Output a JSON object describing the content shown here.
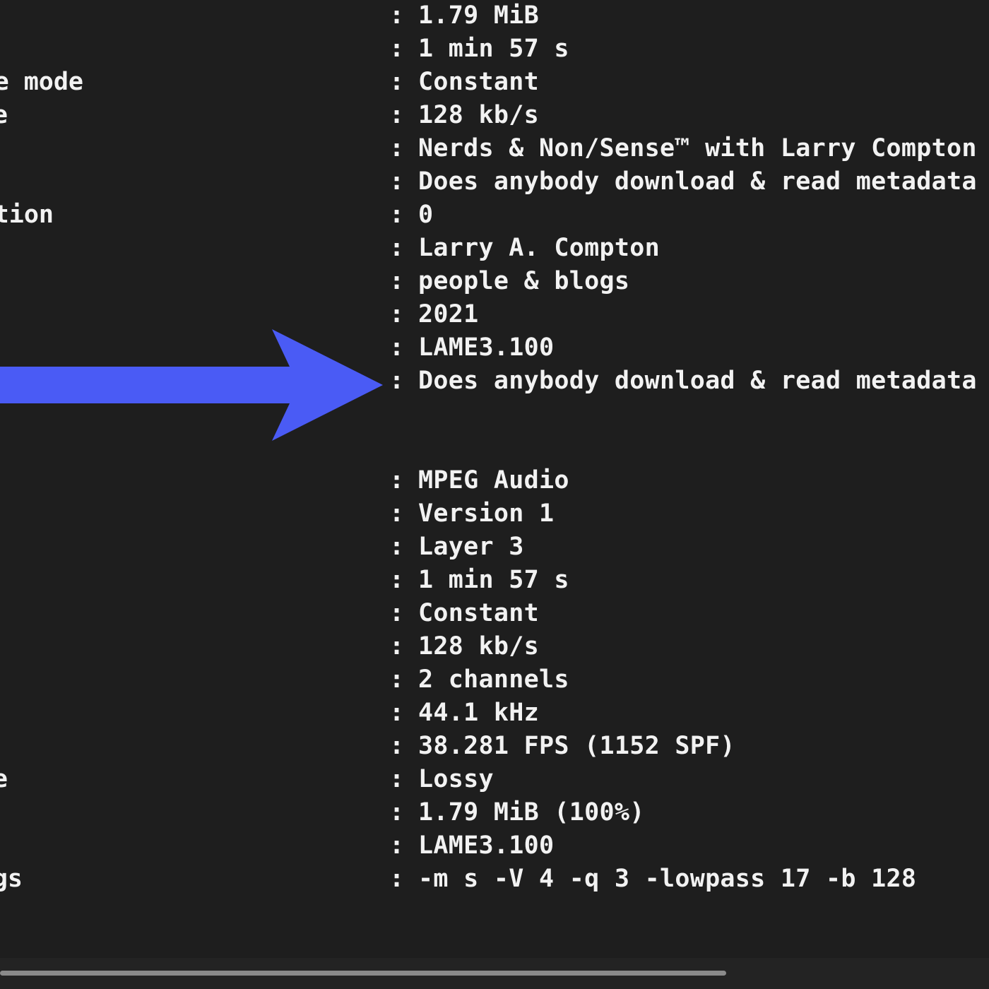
{
  "colors": {
    "background": "#1e1e1e",
    "text": "#f2f2f2",
    "arrow": "#4a5bf5",
    "scroll_track": "#232323",
    "scroll_thumb": "#8a8a8a"
  },
  "general": {
    "lines": [
      {
        "label": "",
        "value": "1.79 MiB"
      },
      {
        "label": "",
        "value": "1 min 57 s"
      },
      {
        "label": "e mode",
        "value": "Constant"
      },
      {
        "label": "e",
        "value": "128 kb/s"
      },
      {
        "label": "",
        "value": "Nerds & Non/Sense™ with Larry Compton"
      },
      {
        "label": "",
        "value": "Does anybody download & read metadata"
      },
      {
        "label": "tion",
        "value": "0"
      },
      {
        "label": "",
        "value": "Larry A. Compton"
      },
      {
        "label": "",
        "value": "people & blogs"
      },
      {
        "label": "",
        "value": "2021"
      },
      {
        "label": "",
        "value": "LAME3.100"
      },
      {
        "label": "",
        "value": "Does anybody download & read metadata"
      }
    ]
  },
  "audio": {
    "lines": [
      {
        "label": "",
        "value": "MPEG Audio"
      },
      {
        "label": "",
        "value": "Version 1"
      },
      {
        "label": "",
        "value": "Layer 3"
      },
      {
        "label": "",
        "value": "1 min 57 s"
      },
      {
        "label": "",
        "value": "Constant"
      },
      {
        "label": "",
        "value": "128 kb/s"
      },
      {
        "label": "",
        "value": "2 channels"
      },
      {
        "label": "",
        "value": "44.1 kHz"
      },
      {
        "label": "",
        "value": "38.281 FPS (1152 SPF)"
      },
      {
        "label": "e",
        "value": "Lossy"
      },
      {
        "label": "",
        "value": "1.79 MiB (100%)"
      },
      {
        "label": "",
        "value": "LAME3.100"
      },
      {
        "label": "gs",
        "value": "-m s -V 4 -q 3 -lowpass 17 -b 128"
      }
    ]
  },
  "separator": ":",
  "icons": {
    "arrow": "right-arrow-icon"
  }
}
